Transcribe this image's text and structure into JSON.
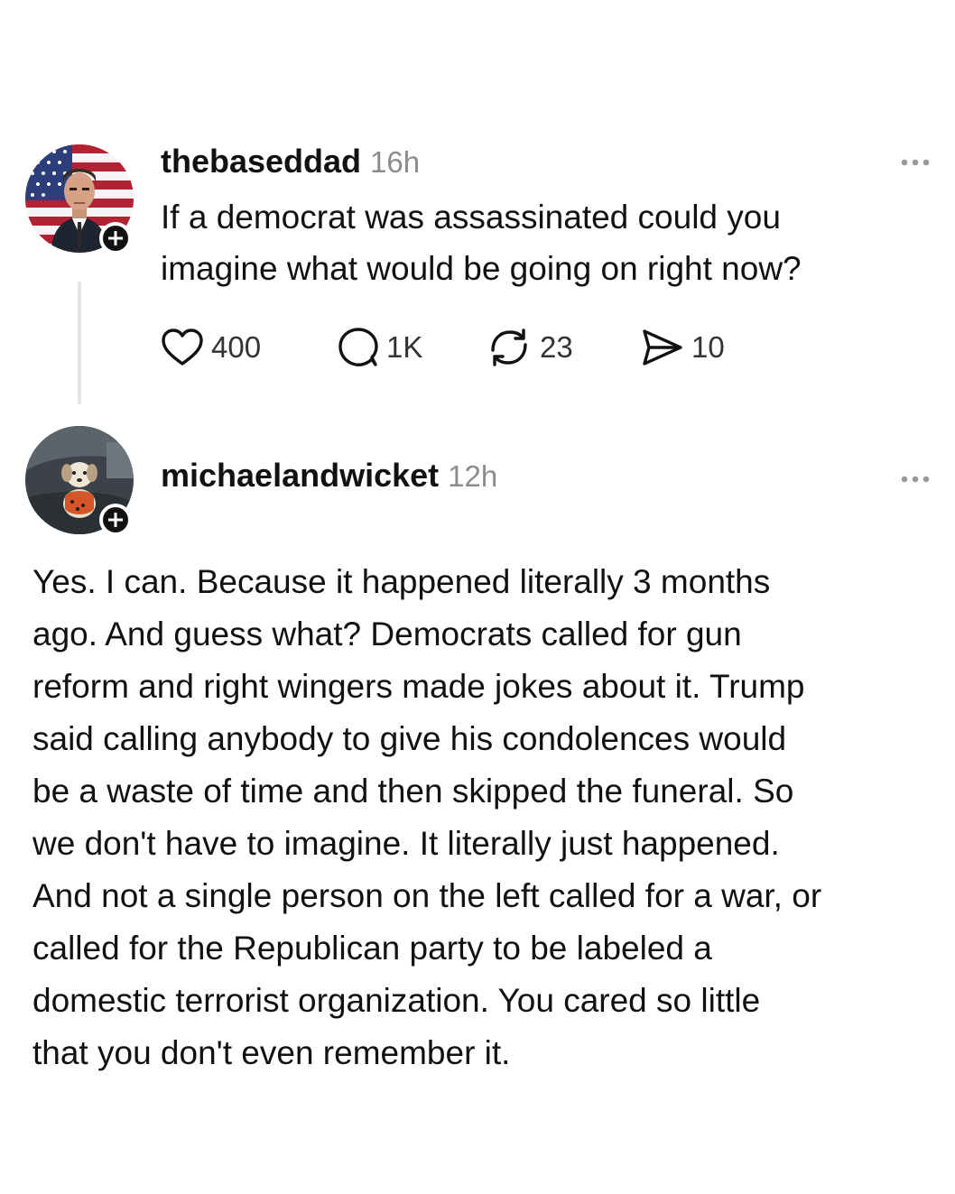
{
  "post": {
    "username": "thebaseddad",
    "timestamp": "16h",
    "text_lines": [
      "If a democrat was assassinated could you",
      "imagine what would be going on right now?"
    ],
    "likes": "400",
    "replies": "1K",
    "reposts": "23",
    "shares": "10",
    "avatar_icon": "avatar-suited-man-flag"
  },
  "reply": {
    "username": "michaelandwicket",
    "timestamp": "12h",
    "avatar_icon": "avatar-dog-in-car",
    "text_lines": [
      "Yes. I can. Because it happened literally 3 months",
      "ago. And guess what? Democrats called for gun",
      "reform and right wingers made jokes about it. Trump",
      "said calling anybody to give his condolences would",
      "be a waste of time and then skipped the funeral. So",
      "we don't have to imagine. It literally just happened.",
      "And not a single person on the left called for a war, or",
      "called for the Republican party to be labeled a",
      "domestic terrorist organization. You cared so little",
      "that you don't even remember it."
    ]
  },
  "colors": {
    "text": "#111111",
    "muted": "#8c8c8c",
    "thread_line": "#e2e2e2",
    "badge": "#111111"
  }
}
